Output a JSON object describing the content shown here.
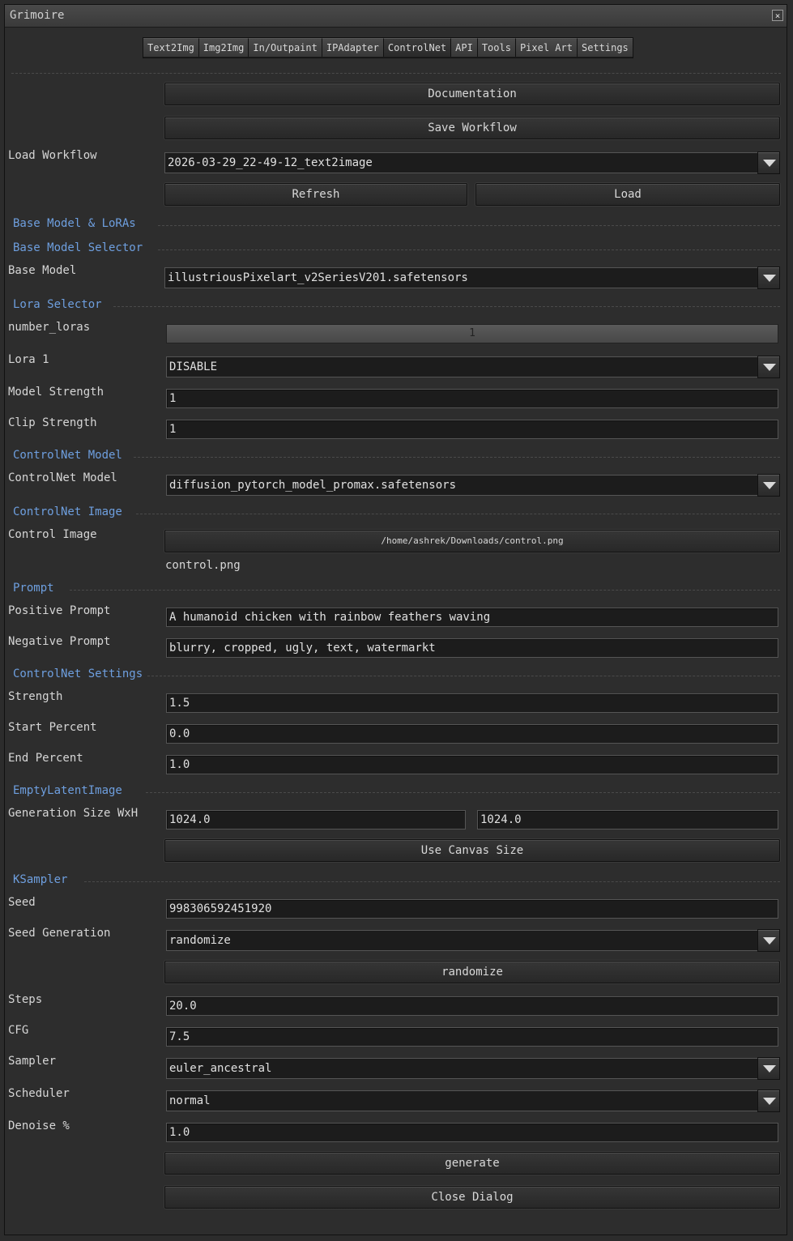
{
  "window": {
    "title": "Grimoire",
    "close_glyph": "×"
  },
  "tabs": [
    "Text2Img",
    "Img2Img",
    "In/Outpaint",
    "IPAdapter",
    "ControlNet",
    "API",
    "Tools",
    "Pixel Art",
    "Settings"
  ],
  "active_tab": "ControlNet",
  "workflow": {
    "documentation": "Documentation",
    "save": "Save Workflow",
    "load_label": "Load Workflow",
    "load_value": "2026-03-29_22-49-12_text2image",
    "refresh": "Refresh",
    "load": "Load"
  },
  "sections": {
    "base_model_loras": "Base Model & LoRAs",
    "base_model_selector": "Base Model Selector",
    "lora_selector": "Lora Selector",
    "controlnet_model": "ControlNet Model",
    "controlnet_image": "ControlNet Image",
    "prompt": "Prompt",
    "controlnet_settings": "ControlNet Settings",
    "empty_latent": "EmptyLatentImage",
    "ksampler": "KSampler"
  },
  "base_model": {
    "label": "Base Model",
    "value": "illustriousPixelart_v2SeriesV201.safetensors"
  },
  "lora": {
    "number_label": "number_loras",
    "number_value": "1",
    "lora1_label": "Lora 1",
    "lora1_value": "DISABLE",
    "model_strength_label": "Model Strength",
    "model_strength": "1",
    "clip_strength_label": "Clip Strength",
    "clip_strength": "1"
  },
  "controlnet_model": {
    "label": "ControlNet Model",
    "value": "diffusion_pytorch_model_promax.safetensors"
  },
  "control_image": {
    "label": "Control Image",
    "path": "/home/ashrek/Downloads/control.png",
    "filename": "control.png"
  },
  "prompt": {
    "positive_label": "Positive Prompt",
    "positive": "A humanoid chicken with rainbow feathers waving",
    "negative_label": "Negative Prompt",
    "negative": "blurry, cropped, ugly, text, watermarkt"
  },
  "cn_settings": {
    "strength_label": "Strength",
    "strength": "1.5",
    "start_label": "Start Percent",
    "start": "0.0",
    "end_label": "End Percent",
    "end": "1.0"
  },
  "latent": {
    "label": "Generation Size WxH",
    "width": "1024.0",
    "height": "1024.0",
    "use_canvas": "Use Canvas Size"
  },
  "ksampler": {
    "seed_label": "Seed",
    "seed": "998306592451920",
    "seed_gen_label": "Seed Generation",
    "seed_gen": "randomize",
    "randomize_btn": "randomize",
    "steps_label": "Steps",
    "steps": "20.0",
    "cfg_label": "CFG",
    "cfg": "7.5",
    "sampler_label": "Sampler",
    "sampler": "euler_ancestral",
    "scheduler_label": "Scheduler",
    "scheduler": "normal",
    "denoise_label": "Denoise %",
    "denoise": "1.0"
  },
  "actions": {
    "generate": "generate",
    "close": "Close Dialog"
  }
}
